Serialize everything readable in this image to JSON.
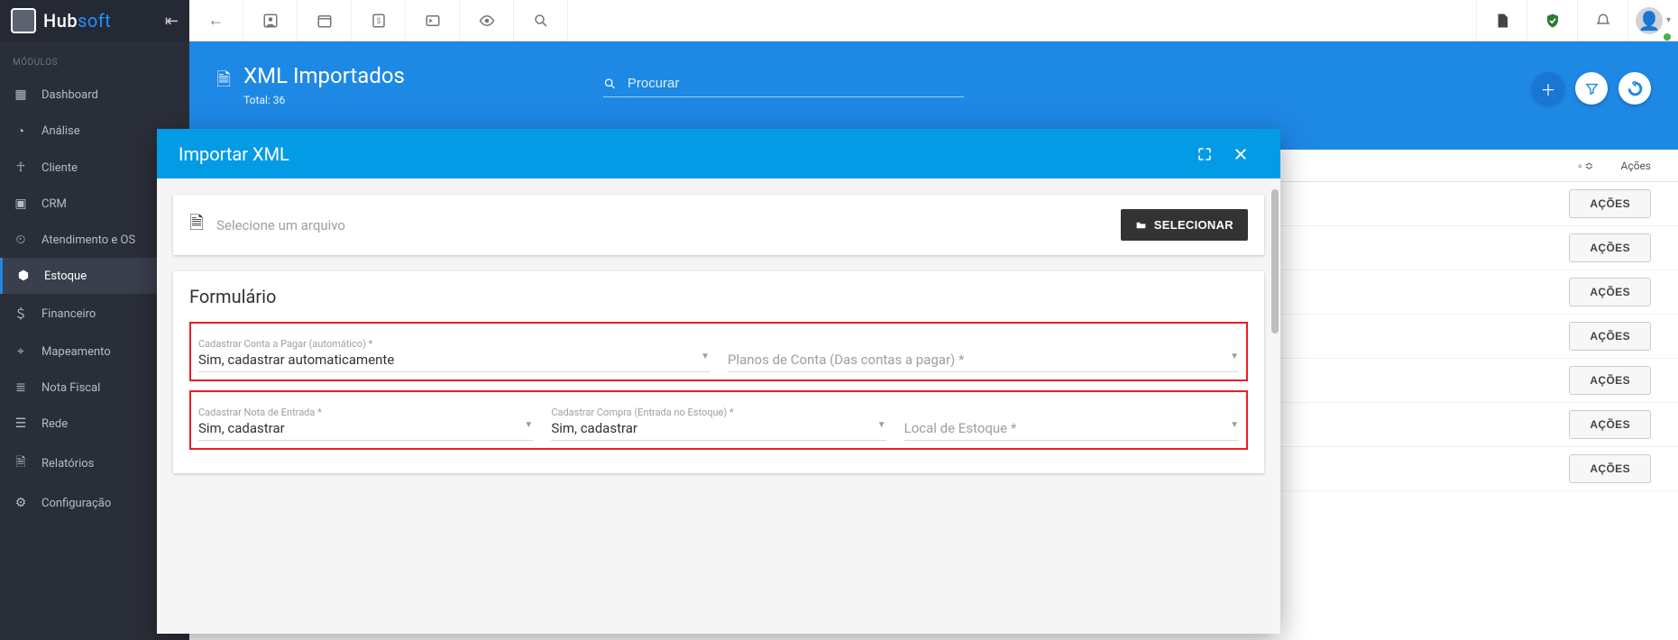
{
  "sidebar": {
    "section_label": "MÓDULOS",
    "items": [
      {
        "label": "Dashboard"
      },
      {
        "label": "Análise"
      },
      {
        "label": "Cliente"
      },
      {
        "label": "CRM"
      },
      {
        "label": "Atendimento e OS"
      },
      {
        "label": "Estoque"
      },
      {
        "label": "Financeiro"
      },
      {
        "label": "Mapeamento"
      },
      {
        "label": "Nota Fiscal"
      },
      {
        "label": "Rede"
      },
      {
        "label": "Relatórios"
      },
      {
        "label": "Configuração"
      }
    ],
    "active_index": 5
  },
  "banner": {
    "title": "XML Importados",
    "subtitle": "Total: 36",
    "search_placeholder": "Procurar"
  },
  "table": {
    "col_sort_hint": "▫ ≎",
    "col_actions": "Ações",
    "action_button": "AÇÕES",
    "rows": 7
  },
  "modal": {
    "title": "Importar XML",
    "file_placeholder": "Selecione um arquivo",
    "select_button": "SELECIONAR",
    "form_title": "Formulário",
    "group1": {
      "field1_label": "Cadastrar Conta a Pagar (automático) *",
      "field1_value": "Sim, cadastrar automaticamente",
      "field2_placeholder": "Planos de Conta (Das contas a pagar) *"
    },
    "group2": {
      "field1_label": "Cadastrar Nota de Entrada *",
      "field1_value": "Sim, cadastrar",
      "field2_label": "Cadastrar Compra (Entrada no Estoque) *",
      "field2_value": "Sim, cadastrar",
      "field3_placeholder": "Local de Estoque *"
    }
  }
}
